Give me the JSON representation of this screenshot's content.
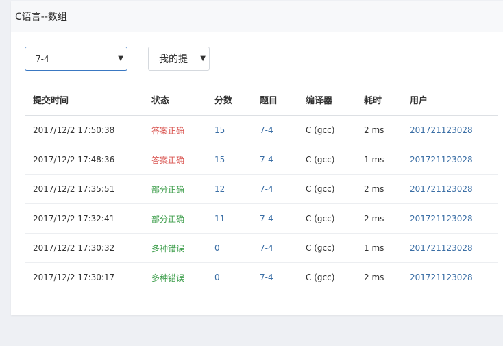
{
  "header": {
    "title": "C语言--数组"
  },
  "filters": {
    "problem_value": "7-4",
    "scope_value": "我的提"
  },
  "table": {
    "columns": [
      "提交时间",
      "状态",
      "分数",
      "题目",
      "编译器",
      "耗时",
      "用户"
    ],
    "rows": [
      {
        "time": "2017/12/2 17:50:38",
        "status": "答案正确",
        "status_type": "correct",
        "score": "15",
        "problem": "7-4",
        "compiler": "C (gcc)",
        "duration": "2 ms",
        "user": "201721123028"
      },
      {
        "time": "2017/12/2 17:48:36",
        "status": "答案正确",
        "status_type": "correct",
        "score": "15",
        "problem": "7-4",
        "compiler": "C (gcc)",
        "duration": "1 ms",
        "user": "201721123028"
      },
      {
        "time": "2017/12/2 17:35:51",
        "status": "部分正确",
        "status_type": "partial",
        "score": "12",
        "problem": "7-4",
        "compiler": "C (gcc)",
        "duration": "2 ms",
        "user": "201721123028"
      },
      {
        "time": "2017/12/2 17:32:41",
        "status": "部分正确",
        "status_type": "partial",
        "score": "11",
        "problem": "7-4",
        "compiler": "C (gcc)",
        "duration": "2 ms",
        "user": "201721123028"
      },
      {
        "time": "2017/12/2 17:30:32",
        "status": "多种错误",
        "status_type": "multiple",
        "score": "0",
        "problem": "7-4",
        "compiler": "C (gcc)",
        "duration": "1 ms",
        "user": "201721123028"
      },
      {
        "time": "2017/12/2 17:30:17",
        "status": "多种错误",
        "status_type": "multiple",
        "score": "0",
        "problem": "7-4",
        "compiler": "C (gcc)",
        "duration": "2 ms",
        "user": "201721123028"
      }
    ]
  },
  "colors": {
    "correct": "#d9534f",
    "partial": "#3c9d4a",
    "multiple": "#3c9d4a",
    "link": "#3a6ea5",
    "focus_border": "#3a78c2"
  },
  "icons": {
    "dropdown": "caret-down-icon"
  }
}
